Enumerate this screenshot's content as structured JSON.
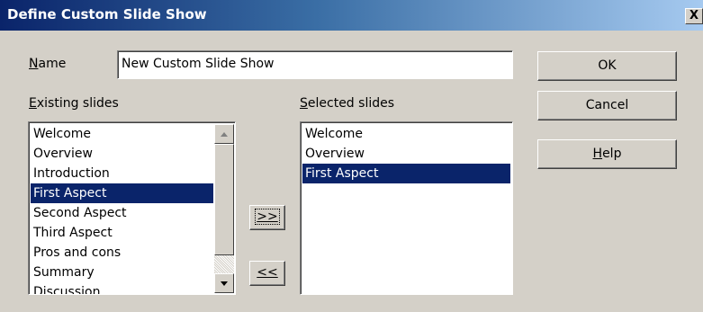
{
  "dialog": {
    "title": "Define Custom Slide Show",
    "close_glyph": "X"
  },
  "name_field": {
    "label_mnemonic": "N",
    "label_rest": "ame",
    "value": "New Custom Slide Show"
  },
  "existing_slides": {
    "label_mnemonic": "E",
    "label_rest": "xisting slides",
    "items": [
      "Welcome",
      "Overview",
      "Introduction",
      "First Aspect",
      "Second Aspect",
      "Third Aspect",
      "Pros and cons",
      "Summary",
      "Discussion"
    ],
    "selected_index": 3
  },
  "selected_slides": {
    "label_mnemonic": "S",
    "label_rest": "elected slides",
    "items": [
      "Welcome",
      "Overview",
      "First Aspect"
    ],
    "selected_index": 2
  },
  "transfer_buttons": {
    "add_label": ">>",
    "remove_label": "<<"
  },
  "buttons": {
    "ok": "OK",
    "cancel": "Cancel",
    "help_mnemonic": "H",
    "help_rest": "elp"
  },
  "colors": {
    "selection_bg": "#0a246a",
    "dialog_bg": "#d4d0c8"
  },
  "icons": {
    "scroll_up": "scroll-up-arrow-icon",
    "scroll_down": "scroll-down-arrow-icon",
    "close": "close-icon"
  }
}
